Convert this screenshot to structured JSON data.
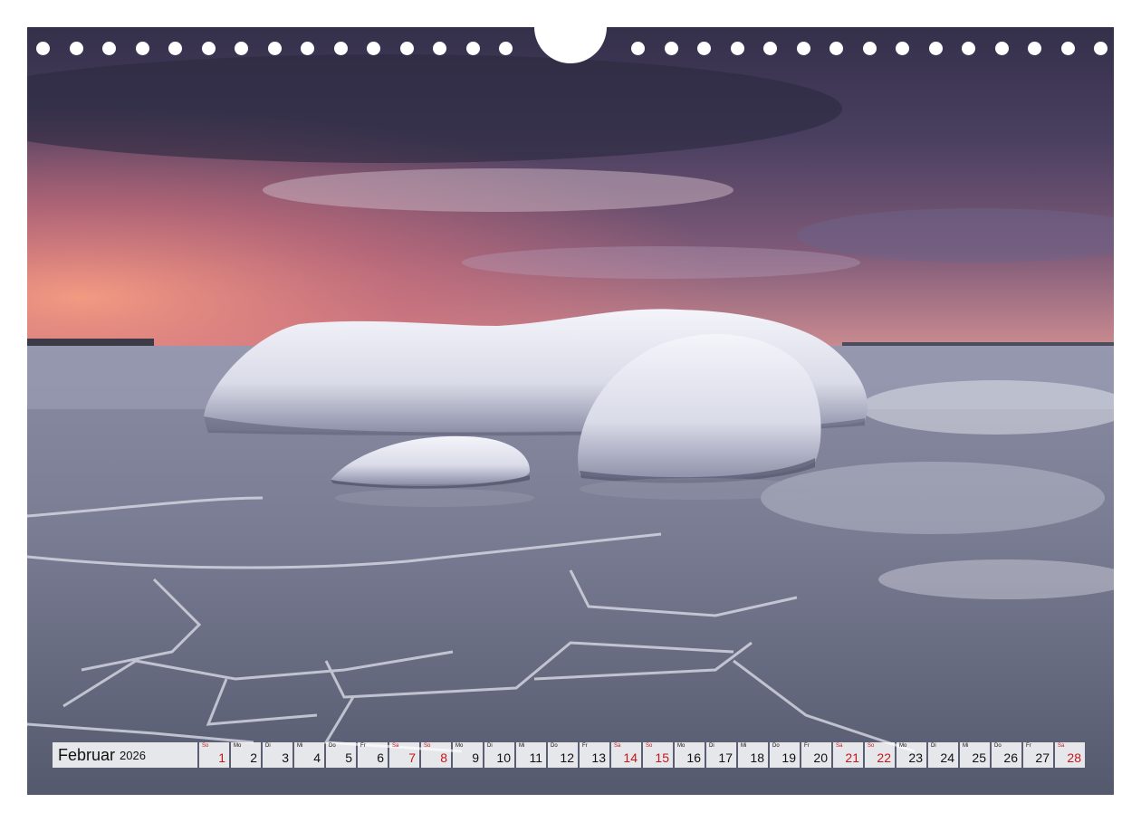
{
  "calendar": {
    "month": "Februar",
    "year": "2026",
    "weekend_color": "#c4161c",
    "days": [
      {
        "wd": "So",
        "num": "1",
        "weekend": true
      },
      {
        "wd": "Mo",
        "num": "2",
        "weekend": false
      },
      {
        "wd": "Di",
        "num": "3",
        "weekend": false
      },
      {
        "wd": "Mi",
        "num": "4",
        "weekend": false
      },
      {
        "wd": "Do",
        "num": "5",
        "weekend": false
      },
      {
        "wd": "Fr",
        "num": "6",
        "weekend": false
      },
      {
        "wd": "Sa",
        "num": "7",
        "weekend": true
      },
      {
        "wd": "So",
        "num": "8",
        "weekend": true
      },
      {
        "wd": "Mo",
        "num": "9",
        "weekend": false
      },
      {
        "wd": "Di",
        "num": "10",
        "weekend": false
      },
      {
        "wd": "Mi",
        "num": "11",
        "weekend": false
      },
      {
        "wd": "Do",
        "num": "12",
        "weekend": false
      },
      {
        "wd": "Fr",
        "num": "13",
        "weekend": false
      },
      {
        "wd": "Sa",
        "num": "14",
        "weekend": true
      },
      {
        "wd": "So",
        "num": "15",
        "weekend": true
      },
      {
        "wd": "Mo",
        "num": "16",
        "weekend": false
      },
      {
        "wd": "Di",
        "num": "17",
        "weekend": false
      },
      {
        "wd": "Mi",
        "num": "18",
        "weekend": false
      },
      {
        "wd": "Do",
        "num": "19",
        "weekend": false
      },
      {
        "wd": "Fr",
        "num": "20",
        "weekend": false
      },
      {
        "wd": "Sa",
        "num": "21",
        "weekend": true
      },
      {
        "wd": "So",
        "num": "22",
        "weekend": true
      },
      {
        "wd": "Mo",
        "num": "23",
        "weekend": false
      },
      {
        "wd": "Di",
        "num": "24",
        "weekend": false
      },
      {
        "wd": "Mi",
        "num": "25",
        "weekend": false
      },
      {
        "wd": "Do",
        "num": "26",
        "weekend": false
      },
      {
        "wd": "Fr",
        "num": "27",
        "weekend": false
      },
      {
        "wd": "Sa",
        "num": "28",
        "weekend": true
      }
    ]
  },
  "photo": {
    "subject": "snow-covered rocks on frozen sea at dusk",
    "sky_colors": [
      "#3b3350",
      "#5a4a6e",
      "#c86a78",
      "#f0907e"
    ],
    "ice_color": "#7d8196"
  }
}
